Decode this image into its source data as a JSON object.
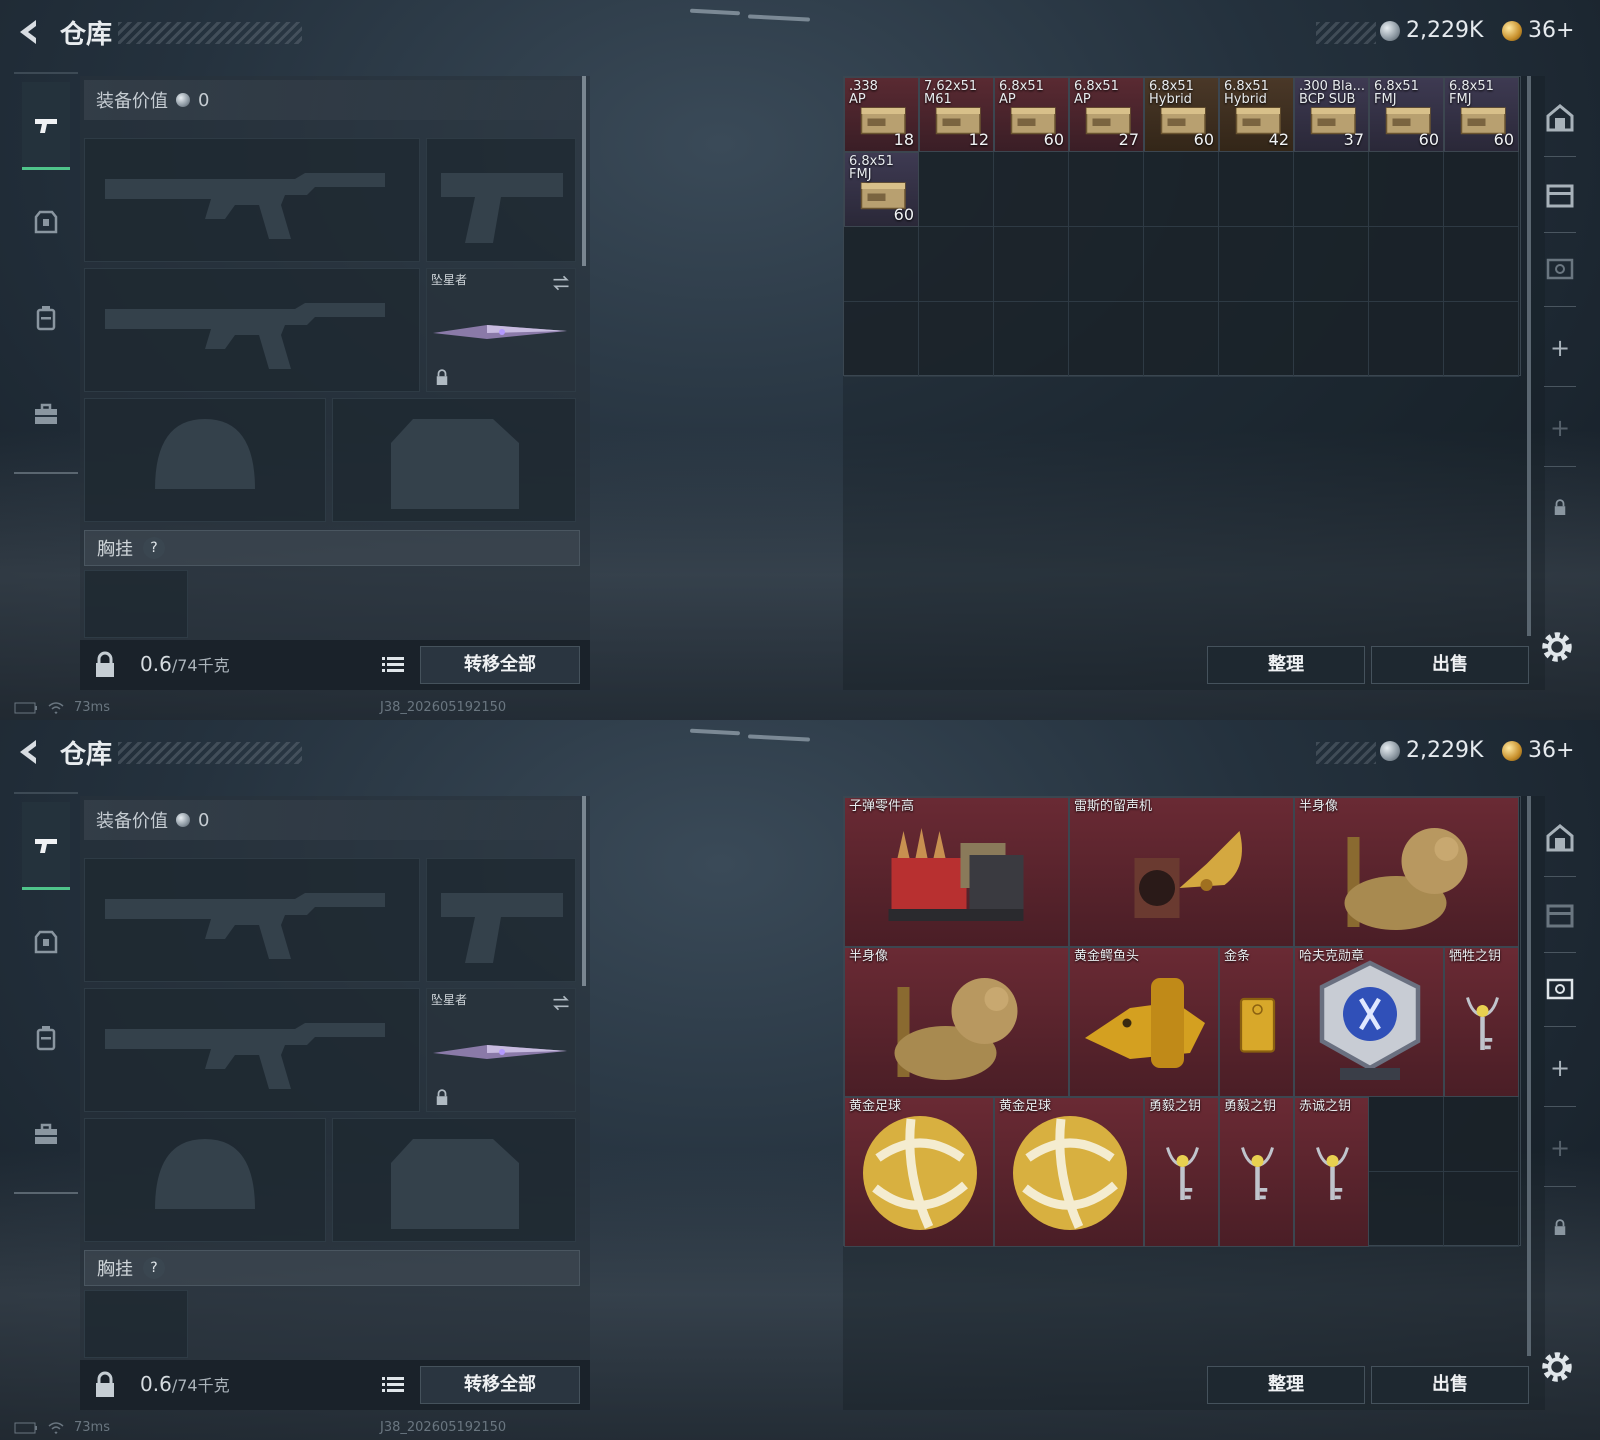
{
  "header": {
    "title": "仓库",
    "silver_amount": "2,229K",
    "gold_amount": "36+"
  },
  "equipment": {
    "value_label": "装备价值",
    "value": "0",
    "melee_name": "坠星者",
    "chest_rig_label": "胸挂",
    "help": "?",
    "weight_current": "0.6",
    "weight_max": "/74千克",
    "transfer_all": "转移全部"
  },
  "status": {
    "ping": "73ms",
    "build_id": "J38_202605192150"
  },
  "buttons": {
    "sort": "整理",
    "sell": "出售"
  },
  "screen1_items": [
    {
      "name": ".338\nAP",
      "count": "18",
      "style": "ammo"
    },
    {
      "name": "7.62x51\nM61",
      "count": "12",
      "style": "ammo"
    },
    {
      "name": "6.8x51\nAP",
      "count": "60",
      "style": "ammo"
    },
    {
      "name": "6.8x51\nAP",
      "count": "27",
      "style": "ammo"
    },
    {
      "name": "6.8x51\nHybrid",
      "count": "60",
      "style": "ammo3"
    },
    {
      "name": "6.8x51\nHybrid",
      "count": "42",
      "style": "ammo3"
    },
    {
      "name": ".300 Bla...\nBCP SUB",
      "count": "37",
      "style": "ammo2"
    },
    {
      "name": "6.8x51\nFMJ",
      "count": "60",
      "style": "ammo2"
    },
    {
      "name": "6.8x51\nFMJ",
      "count": "60",
      "style": "ammo2"
    },
    {
      "name": "6.8x51\nFMJ",
      "count": "60",
      "style": "ammo2"
    }
  ],
  "screen2_items": [
    {
      "name": "子弹零件高",
      "icon": "ammo-parts-crate-icon"
    },
    {
      "name": "雷斯的留声机",
      "icon": "gramophone-icon"
    },
    {
      "name": "半身像",
      "icon": "bust-icon"
    },
    {
      "name": "半身像",
      "icon": "bust-icon"
    },
    {
      "name": "黄金鳄鱼头",
      "icon": "golden-crocodile-head-icon"
    },
    {
      "name": "金条",
      "icon": "gold-bar-icon"
    },
    {
      "name": "哈夫克勋章",
      "icon": "medal-icon"
    },
    {
      "name": "牺牲之钥",
      "icon": "key-icon"
    },
    {
      "name": "黄金足球",
      "icon": "golden-football-icon"
    },
    {
      "name": "黄金足球",
      "icon": "golden-football-icon"
    },
    {
      "name": "勇毅之钥",
      "icon": "key-icon"
    },
    {
      "name": "勇毅之钥",
      "icon": "key-icon"
    },
    {
      "name": "赤诚之钥",
      "icon": "key-icon"
    }
  ],
  "colors": {
    "accent_green": "#4fc48a",
    "item_red": "#5a2a32",
    "gold": "#c8902c"
  }
}
